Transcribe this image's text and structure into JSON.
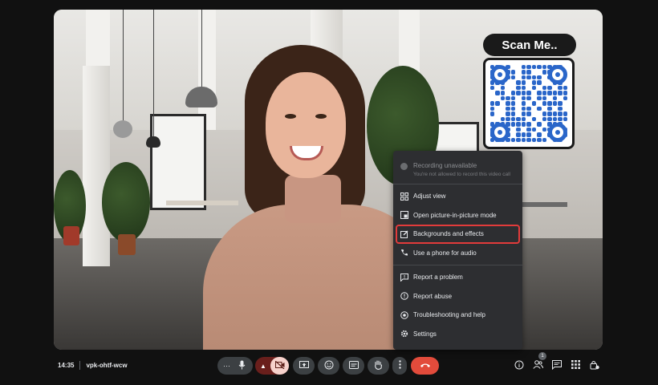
{
  "qr": {
    "label": "Scan Me.."
  },
  "menu": {
    "recording": {
      "title": "Recording unavailable",
      "subtitle": "You're not allowed to record this video call"
    },
    "items": [
      {
        "label": "Adjust view",
        "icon": "grid-layout-icon"
      },
      {
        "label": "Open picture-in-picture mode",
        "icon": "picture-in-picture-icon"
      },
      {
        "label": "Backgrounds and effects",
        "icon": "edit-background-icon",
        "highlighted": true
      },
      {
        "label": "Use a phone for audio",
        "icon": "phone-icon"
      }
    ],
    "items2": [
      {
        "label": "Report a problem",
        "icon": "feedback-icon"
      },
      {
        "label": "Report abuse",
        "icon": "warning-icon"
      },
      {
        "label": "Troubleshooting and help",
        "icon": "help-icon"
      },
      {
        "label": "Settings",
        "icon": "gear-icon"
      }
    ]
  },
  "meeting": {
    "time": "14:35",
    "code": "vpk-ohtf-wcw"
  },
  "controls": {
    "more_dots": "···",
    "mic_icon": "microphone-icon",
    "camera_off_icon": "camera-off-icon",
    "present_icon": "present-screen-icon",
    "emoji_icon": "emoji-icon",
    "captions_icon": "captions-icon",
    "raise_hand_icon": "raise-hand-icon",
    "more_options_icon": "more-vert-icon",
    "end_call_icon": "end-call-icon"
  },
  "right_controls": {
    "participants_count": "1"
  },
  "colors": {
    "end_call": "#e24b3b",
    "highlight_outline": "#e23b3b",
    "menu_bg": "#2d2e31",
    "qr_blue": "#2a66c9"
  }
}
